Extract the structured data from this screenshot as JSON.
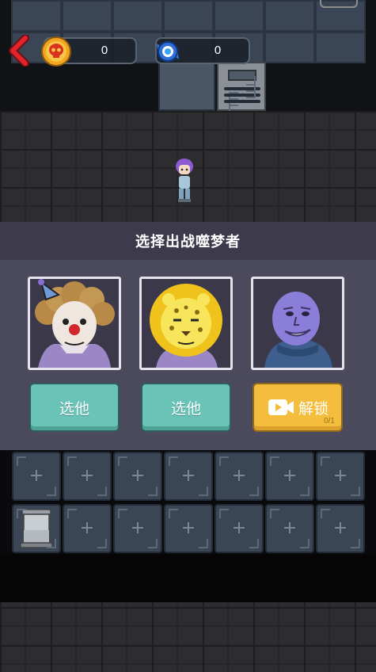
{
  "hud": {
    "back_icon": "chevron-left-icon",
    "coin_counter": {
      "icon": "skull-coin-icon",
      "value": "0"
    },
    "gem_counter": {
      "icon": "blue-candy-icon",
      "value": "0"
    }
  },
  "panel": {
    "title": "选择出战噬梦者",
    "characters": [
      {
        "name": "clown-portrait",
        "button_label": "选他"
      },
      {
        "name": "leopard-lion-portrait",
        "button_label": "选他"
      },
      {
        "name": "purple-man-portrait",
        "button_label": "解锁",
        "unlock_count": "0/1"
      }
    ]
  },
  "grid": {
    "rows": 2,
    "columns": 7,
    "empty_slot_icon": "+",
    "occupied_slot": "bed-icon"
  },
  "colors": {
    "pick_button": "#69c4b7",
    "unlock_button": "#f5bd3c",
    "panel_bg": "#4a4a5c",
    "panel_header_bg": "#3d3a4c",
    "back_arrow": "#e0232d"
  }
}
